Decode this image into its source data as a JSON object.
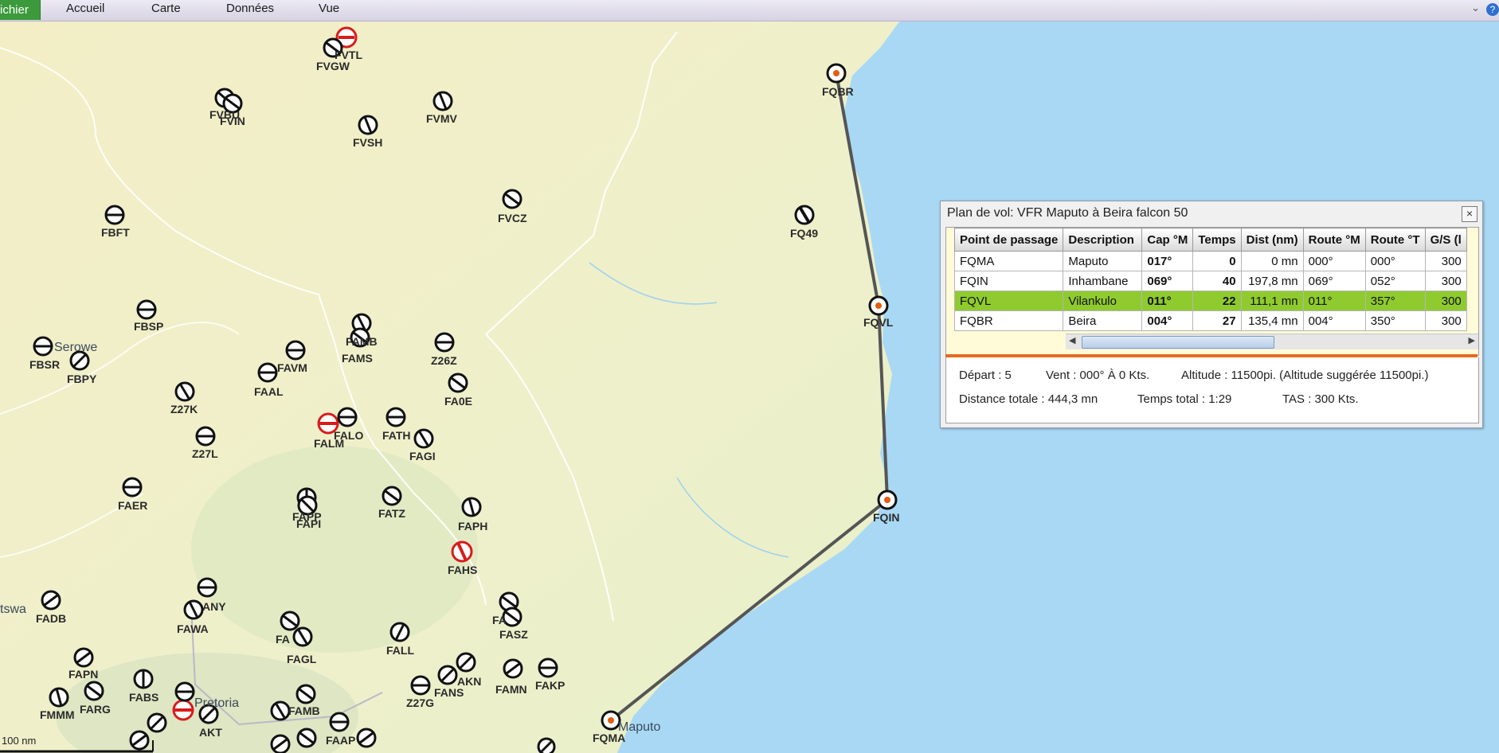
{
  "ribbon": {
    "file_tab": "ichier",
    "tabs": [
      "Accueil",
      "Carte",
      "Données",
      "Vue"
    ]
  },
  "map": {
    "scale_label": "100 nm",
    "place_labels": {
      "maputo": "Maputo",
      "pretoria": "Pretoria",
      "serowe": "Serowe",
      "botswana": "tswa"
    },
    "airports": {
      "fqbr": "FQBR",
      "fq49": "FQ49",
      "fqvl": "FQVL",
      "fqin": "FQIN",
      "fqma": "FQMA",
      "fvtl": "FVTL",
      "fvgw": "FVGW",
      "fvbu": "FVBU",
      "fvin": "FVIN",
      "fvmv": "FVMV",
      "fvsh": "FVSH",
      "fvcz": "FVCZ",
      "fbft": "FBFT",
      "fbsp": "FBSP",
      "fbsr": "FBSR",
      "fbpy": "FBPY",
      "favm": "FAVM",
      "faal": "FAAL",
      "fams": "FAMS",
      "famb": "FAMB",
      "z26z": "Z26Z",
      "fa0e": "FA0E",
      "z27k": "Z27K",
      "z27l": "Z27L",
      "falm": "FALM",
      "falo": "FALO",
      "fath": "FATH",
      "fagi": "FAGI",
      "faer": "FAER",
      "fapp": "FAPP",
      "fapi": "FAPI",
      "fatz": "FATZ",
      "faph": "FAPH",
      "fahs": "FAHS",
      "fadb": "FADB",
      "fany": "ANY",
      "fawa": "FAWA",
      "fagl": "FAGL",
      "fall": "FALL",
      "fasz": "FASZ",
      "fapn": "FAPN",
      "fabs": "FABS",
      "farg": "FARG",
      "fmmm": "FMMM",
      "famb2": "FAMB",
      "fans": "FANS",
      "fakn": "AKN",
      "famn": "FAMN",
      "fakp": "FAKP",
      "z27g": "Z27G",
      "faap": "FAAP",
      "fakt": "AKT"
    }
  },
  "flight_plan": {
    "title": "Plan de vol: VFR Maputo à Beira falcon 50",
    "columns": [
      "Point de passage",
      "Description",
      "Cap °M",
      "Temps",
      "Dist (nm)",
      "Route °M",
      "Route °T",
      "G/S (l"
    ],
    "rows": [
      {
        "point": "FQMA",
        "desc": "Maputo",
        "cap": "017°",
        "temps": "0",
        "dist": "0 mn",
        "route_m": "000°",
        "route_t": "000°",
        "gs": "300"
      },
      {
        "point": "FQIN",
        "desc": "Inhambane",
        "cap": "069°",
        "temps": "40",
        "dist": "197,8 mn",
        "route_m": "069°",
        "route_t": "052°",
        "gs": "300"
      },
      {
        "point": "FQVL",
        "desc": "Vilankulo",
        "cap": "011°",
        "temps": "22",
        "dist": "111,1 mn",
        "route_m": "011°",
        "route_t": "357°",
        "gs": "300"
      },
      {
        "point": "FQBR",
        "desc": "Beira",
        "cap": "004°",
        "temps": "27",
        "dist": "135,4 mn",
        "route_m": "004°",
        "route_t": "350°",
        "gs": "300"
      }
    ],
    "selected_row": 2,
    "info": {
      "depart": "Départ :  5",
      "vent": "Vent :  000° À 0 Kts.",
      "altitude": "Altitude :  11500pi. (Altitude suggérée 11500pi.)",
      "distance": "Distance totale :  444,3 mn",
      "temps_total": "Temps total :  1:29",
      "tas": "TAS :  300 Kts."
    }
  },
  "colors": {
    "land": "#f1efc8",
    "sea": "#a9d8f5",
    "route": "#555555",
    "selected_row": "#8fcb2f",
    "ribbon_file": "#3c9a3c"
  }
}
